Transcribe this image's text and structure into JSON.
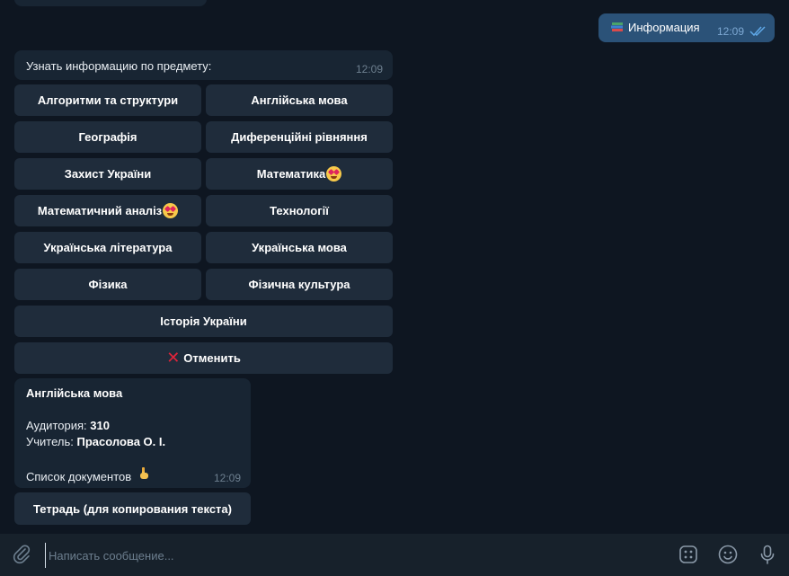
{
  "outgoing": {
    "emoji": "books-emoji",
    "text": "Информация",
    "time": "12:09"
  },
  "prompt": {
    "text": "Узнать информацию по предмету:",
    "time": "12:09"
  },
  "keyboard": {
    "algorithms": "Алгоритми та структури",
    "english": "Англійська мова",
    "geography": "Географія",
    "diff_equations": "Диференційні рівняння",
    "defense": "Захист України",
    "math": "Математика",
    "math_analysis": "Математичний аналіз",
    "technology": "Технології",
    "ukr_literature": "Українська література",
    "ukr_language": "Українська мова",
    "physics": "Фізика",
    "phys_culture": "Фізична культура",
    "history": "Історія України",
    "cancel": "Отменить"
  },
  "info": {
    "title": "Англійська мова",
    "room_label": "Аудитория:",
    "room_value": "310",
    "teacher_label": "Учитель:",
    "teacher_value": "Прасолова О. І.",
    "docs_label": "Список документов",
    "time": "12:09"
  },
  "copy_button": "Тетрадь (для копирования текста)",
  "composer": {
    "placeholder": "Написать сообщение..."
  },
  "colors": {
    "background": "#0e1621",
    "incoming_bubble": "#182533",
    "outgoing_bubble": "#2b5278",
    "keyboard_button": "#1f2c3b",
    "input_bar": "#17212b"
  }
}
